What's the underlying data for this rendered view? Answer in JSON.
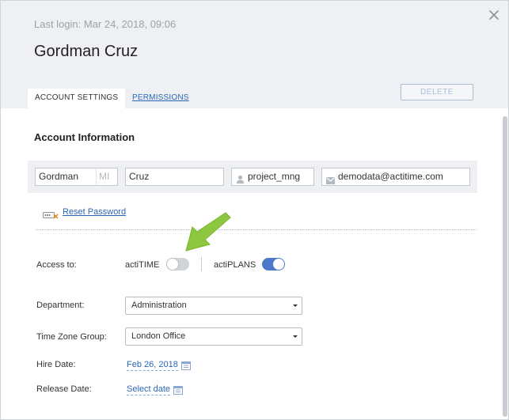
{
  "header": {
    "last_login": "Last login: Mar 24, 2018, 09:06",
    "user_name": "Gordman Cruz",
    "tabs": [
      {
        "label": "ACCOUNT SETTINGS",
        "active": true
      },
      {
        "label": "PERMISSIONS",
        "active": false
      }
    ],
    "delete_label": "DELETE",
    "close_icon": "close-icon"
  },
  "account_info": {
    "title": "Account Information",
    "first_name": "Gordman",
    "middle_initial_placeholder": "MI",
    "last_name": "Cruz",
    "username": "project_mng",
    "email": "demodata@actitime.com",
    "reset_password": "Reset Password"
  },
  "access": {
    "label": "Access to:",
    "products": [
      {
        "name": "actiTIME",
        "enabled": false
      },
      {
        "name": "actiPLANS",
        "enabled": true
      }
    ]
  },
  "department": {
    "label": "Department:",
    "value": "Administration"
  },
  "time_zone_group": {
    "label": "Time Zone Group:",
    "value": "London Office"
  },
  "hire_date": {
    "label": "Hire Date:",
    "value": "Feb 26, 2018"
  },
  "release_date": {
    "label": "Release Date:",
    "value": "Select date"
  },
  "colors": {
    "accent": "#2b66b8",
    "toggle_on": "#4a7ac9",
    "annotation_arrow": "#8dc63f"
  }
}
